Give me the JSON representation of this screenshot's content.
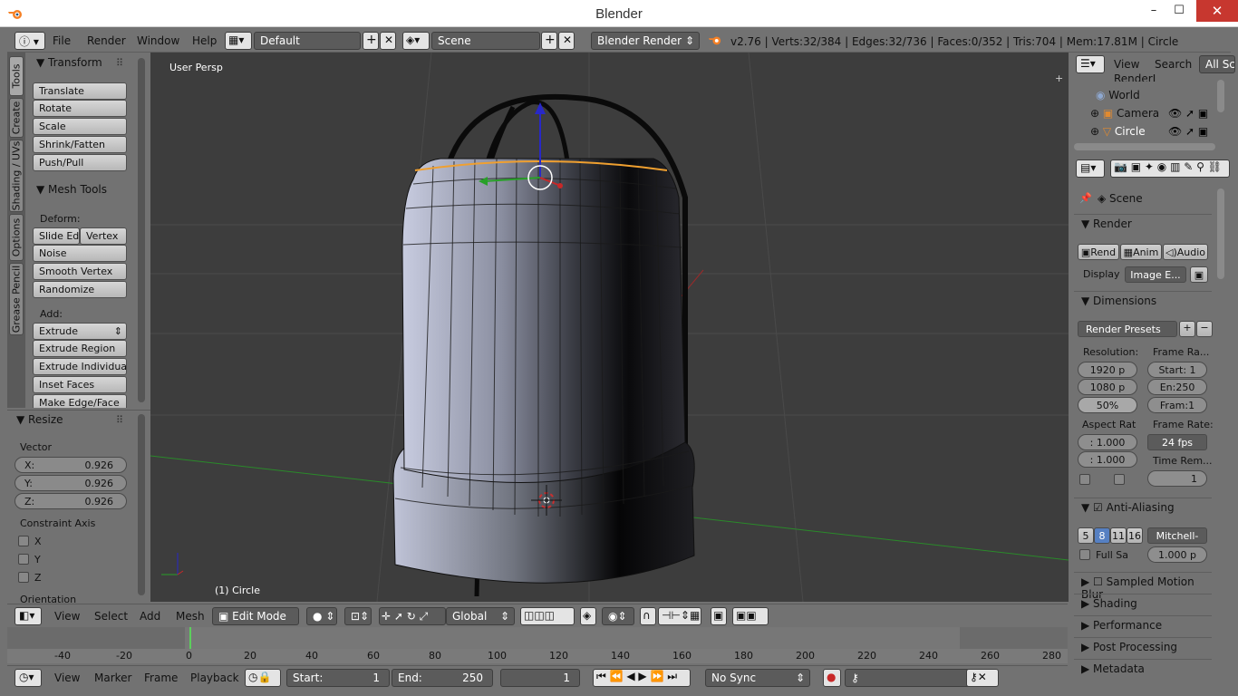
{
  "window": {
    "title": "Blender",
    "minimize": "–",
    "maximize": "☐",
    "close": "✕"
  },
  "topbar": {
    "menus": [
      "File",
      "Render",
      "Window",
      "Help"
    ],
    "layout": "Default",
    "scene": "Scene",
    "engine": "Blender Render",
    "stats": "v2.76 | Verts:32/384 | Edges:32/736 | Faces:0/352 | Tris:704 | Mem:17.81M | Circle"
  },
  "left_tabs": [
    "Tools",
    "Create",
    "Shading / UVs",
    "Options",
    "Grease Pencil"
  ],
  "tools": {
    "transform_title": "Transform",
    "transform_buttons": [
      "Translate",
      "Rotate",
      "Scale",
      "Shrink/Fatten",
      "Push/Pull"
    ],
    "mesh_tools_title": "Mesh Tools",
    "deform_label": "Deform:",
    "slide_edge": "Slide Ed",
    "vertex": "Vertex",
    "deform_buttons": [
      "Noise",
      "Smooth Vertex",
      "Randomize"
    ],
    "add_label": "Add:",
    "extrude": "Extrude",
    "add_buttons": [
      "Extrude Region",
      "Extrude Individual",
      "Inset Faces",
      "Make Edge/Face"
    ]
  },
  "resize": {
    "title": "Resize",
    "vector_label": "Vector",
    "x_label": "X:",
    "x": "0.926",
    "y_label": "Y:",
    "y": "0.926",
    "z_label": "Z:",
    "z": "0.926",
    "constraint_label": "Constraint Axis",
    "axes": [
      "X",
      "Y",
      "Z"
    ],
    "orientation_label": "Orientation"
  },
  "viewport": {
    "view_name": "User Persp",
    "object_label": "(1) Circle"
  },
  "viewport_header": {
    "menus": [
      "View",
      "Select",
      "Add",
      "Mesh"
    ],
    "mode": "Edit Mode",
    "orientation": "Global"
  },
  "timeline": {
    "ticks": [
      "-40",
      "-20",
      "0",
      "20",
      "40",
      "60",
      "80",
      "100",
      "120",
      "140",
      "160",
      "180",
      "200",
      "220",
      "240",
      "260",
      "280"
    ],
    "menus": [
      "View",
      "Marker",
      "Frame",
      "Playback"
    ],
    "start_label": "Start:",
    "start": "1",
    "end_label": "End:",
    "end": "250",
    "current": "1",
    "sync": "No Sync"
  },
  "outliner": {
    "menus": [
      "View",
      "Search"
    ],
    "filter": "All Sc",
    "items": [
      "RenderL",
      "World",
      "Camera",
      "Circle"
    ]
  },
  "properties": {
    "context": "Scene",
    "render_title": "Render",
    "render_btn": "Rend",
    "anim_btn": "Anim",
    "audio_btn": "Audio",
    "display_label": "Display",
    "display_value": "Image E...",
    "dimensions_title": "Dimensions",
    "presets": "Render Presets",
    "resolution_label": "Resolution:",
    "res_x": "1920 p",
    "res_y": "1080 p",
    "res_pct": "50%",
    "frame_range_label": "Frame Ra...",
    "frame_start": "Start: 1",
    "frame_end": "En:250",
    "frame_step": "Fram:1",
    "aspect_label": "Aspect Rat",
    "aspect_x": ": 1.000",
    "aspect_y": ": 1.000",
    "frame_rate_label": "Frame Rate:",
    "frame_rate": "24 fps",
    "time_remap_label": "Time Rem...",
    "time_remap": "1",
    "aa_title": "Anti-Aliasing",
    "aa_samples": [
      "5",
      "8",
      "11",
      "16"
    ],
    "aa_filter": "Mitchell-",
    "full_sample": "Full Sa",
    "filter_size": "1.000 p",
    "collapsed_sections": [
      "Sampled Motion Blur",
      "Shading",
      "Performance",
      "Post Processing",
      "Metadata"
    ]
  },
  "colors": {
    "accent": "#5680c2",
    "selected_edge": "#f0a030",
    "x_axis": "#c82828",
    "y_axis": "#28a028",
    "z_axis": "#2828c8"
  }
}
